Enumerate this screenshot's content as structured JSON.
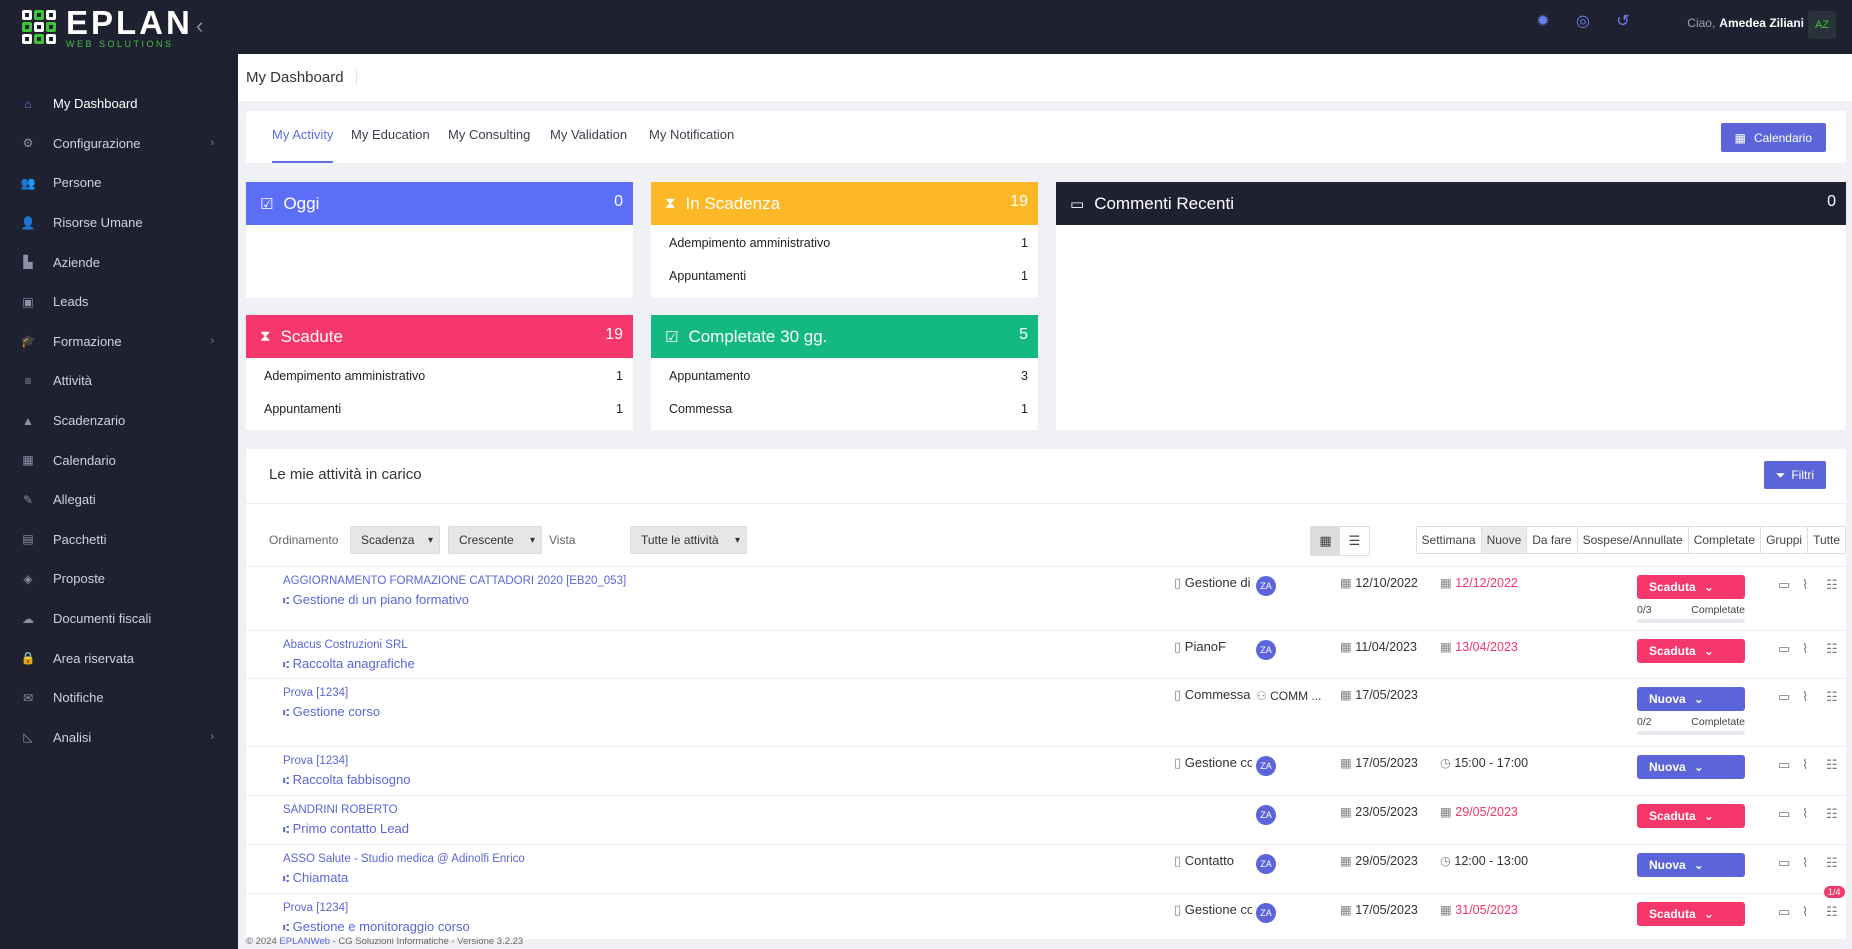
{
  "app": {
    "brand_main": "EPLAN",
    "brand_sub": "WEB SOLUTIONS"
  },
  "sidebar": {
    "items": [
      {
        "label": "My Dashboard",
        "icon": "home-icon"
      },
      {
        "label": "Configurazione",
        "icon": "gear-icon"
      },
      {
        "label": "Persone",
        "icon": "users-icon"
      },
      {
        "label": "Risorse Umane",
        "icon": "user-icon"
      },
      {
        "label": "Aziende",
        "icon": "industry-icon"
      },
      {
        "label": "Leads",
        "icon": "contact-book-icon"
      },
      {
        "label": "Formazione",
        "icon": "graduation-cap-icon"
      },
      {
        "label": "Attività",
        "icon": "list-icon"
      },
      {
        "label": "Scadenzario",
        "icon": "warning-icon"
      },
      {
        "label": "Calendario",
        "icon": "calendar-icon"
      },
      {
        "label": "Allegati",
        "icon": "paperclip-icon"
      },
      {
        "label": "Pacchetti",
        "icon": "package-icon"
      },
      {
        "label": "Proposte",
        "icon": "handshake-icon"
      },
      {
        "label": "Documenti fiscali",
        "icon": "cloud-icon"
      },
      {
        "label": "Area riservata",
        "icon": "user-lock-icon"
      },
      {
        "label": "Notifiche",
        "icon": "envelope-icon"
      },
      {
        "label": "Analisi",
        "icon": "chart-icon"
      }
    ]
  },
  "topbar": {
    "greeting": "Ciao,",
    "user_name": "Amedea Ziliani",
    "avatar": "AZ"
  },
  "page": {
    "title": "My Dashboard"
  },
  "tabs": [
    "My Activity",
    "My Education",
    "My Consulting",
    "My Validation",
    "My Notification"
  ],
  "calendar_button": "Calendario",
  "cards": {
    "oggi": {
      "title": "Oggi",
      "count": "0"
    },
    "in_scadenza": {
      "title": "In Scadenza",
      "count": "19",
      "rows": [
        {
          "label": "Adempimento amministrativo",
          "value": "1"
        },
        {
          "label": "Appuntamenti",
          "value": "1"
        }
      ]
    },
    "commenti": {
      "title": "Commenti Recenti",
      "count": "0"
    },
    "scadute": {
      "title": "Scadute",
      "count": "19",
      "rows": [
        {
          "label": "Adempimento amministrativo",
          "value": "1"
        },
        {
          "label": "Appuntamenti",
          "value": "1"
        }
      ]
    },
    "completate": {
      "title": "Completate 30 gg.",
      "count": "5",
      "rows": [
        {
          "label": "Appuntamento",
          "value": "3"
        },
        {
          "label": "Commessa",
          "value": "1"
        }
      ]
    }
  },
  "list": {
    "title": "Le mie attività in carico",
    "filters_button": "Filtri",
    "ordinamento_label": "Ordinamento",
    "sort_field": "Scadenza",
    "sort_order": "Crescente",
    "vista_label": "Vista",
    "vista_value": "Tutte le attività",
    "periods": [
      "Settimana",
      "Nuove",
      "Da fare",
      "Sospese/Annullate",
      "Completate",
      "Gruppi",
      "Tutte"
    ],
    "rows": [
      {
        "ref": "AGGIORNAMENTO FORMAZIONE CATTADORI 2020 [EB20_053]",
        "name": "Gestione di un piano formativo",
        "type": "Gestione di un piano",
        "assignee": "ZA",
        "date1": "12/10/2022",
        "date2": "12/12/2022",
        "status": "Scaduta",
        "progress": "0/3",
        "progress_label": "Completate"
      },
      {
        "ref": "Abacus Costruzioni SRL",
        "name": "Raccolta anagrafiche",
        "type": "PianoF",
        "assignee": "ZA",
        "date1": "11/04/2023",
        "date2": "13/04/2023",
        "status": "Scaduta"
      },
      {
        "ref": "Prova [1234]",
        "name": "Gestione corso",
        "type": "Commessa",
        "assignee": "COMM ...",
        "date1": "17/05/2023",
        "date2": "",
        "status": "Nuova",
        "progress": "0/2",
        "progress_label": "Completate"
      },
      {
        "ref": "Prova [1234]",
        "name": "Raccolta fabbisogno",
        "type": "Gestione corso",
        "assignee": "ZA",
        "date1": "17/05/2023",
        "date2": "15:00 - 17:00",
        "status": "Nuova"
      },
      {
        "ref": "SANDRINI ROBERTO",
        "name": "Primo contatto Lead",
        "type": "",
        "assignee": "ZA",
        "date1": "23/05/2023",
        "date2": "29/05/2023",
        "status": "Scaduta"
      },
      {
        "ref": "ASSO Salute - Studio medica @ Adinolfi Enrico",
        "name": "Chiamata",
        "type": "Contatto",
        "assignee": "ZA",
        "date1": "29/05/2023",
        "date2": "12:00 - 13:00",
        "status": "Nuova"
      },
      {
        "ref": "Prova [1234]",
        "name": "Gestione e monitoraggio corso",
        "type": "Gestione corso",
        "assignee": "ZA",
        "date1": "17/05/2023",
        "date2": "31/05/2023",
        "status": "Scaduta",
        "badge": "1/4"
      }
    ]
  },
  "footer": {
    "prefix": "© 2024",
    "product": "EPLANWeb",
    "company": "- CG Soluzioni Informatiche - Versione 3.2.23"
  },
  "colors": {
    "accent": "#5b65d9",
    "pink": "#f6376c",
    "yellow": "#fdb828",
    "green": "#13b981",
    "dark": "#1f2131"
  }
}
